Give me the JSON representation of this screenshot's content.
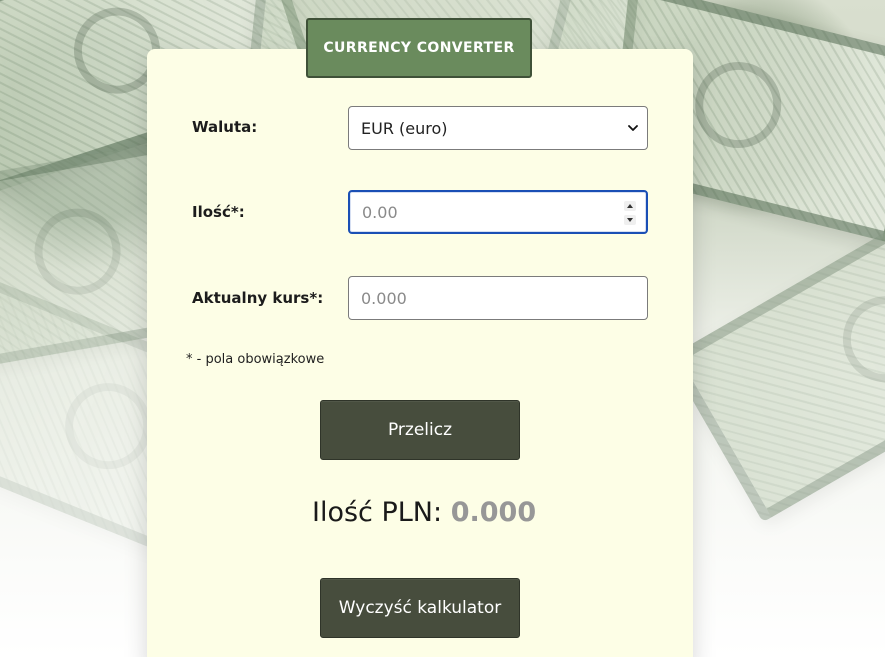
{
  "header": {
    "title": "CURRENCY CONVERTER"
  },
  "form": {
    "currency_label": "Waluta:",
    "currency_selected": "EUR (euro)",
    "amount_label": "Ilość*:",
    "amount_placeholder": "0.00",
    "rate_label": "Aktualny kurs*:",
    "rate_placeholder": "0.000",
    "required_note": "* - pola obowiązkowe"
  },
  "actions": {
    "convert_label": "Przelicz",
    "reset_label": "Wyczyść kalkulator"
  },
  "result": {
    "label": "Ilość PLN:",
    "value": "0.000"
  },
  "icons": {
    "select": "chevron-down-icon",
    "number_up": "caret-up-icon",
    "number_down": "caret-down-icon"
  },
  "colors": {
    "panel": "#fdfee6",
    "badge": "#6a8b5d",
    "button": "#474d3d",
    "focus": "#1a4fb5",
    "result_value": "#979797"
  }
}
